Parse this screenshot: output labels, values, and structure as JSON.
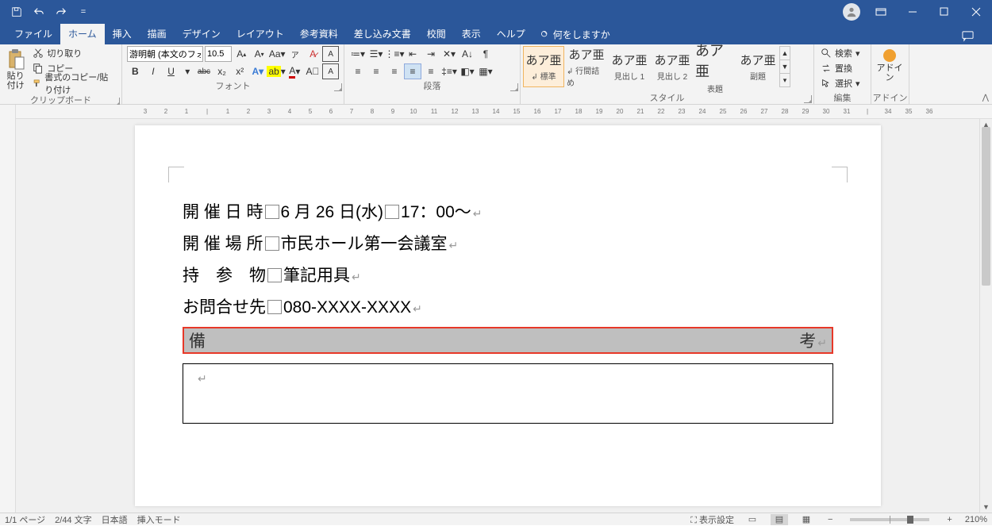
{
  "qat": {
    "save": "保存",
    "undo": "元に戻す",
    "redo": "やり直し",
    "custom": "="
  },
  "window": {
    "account": "アカウント"
  },
  "tabs": {
    "file": "ファイル",
    "home": "ホーム",
    "insert": "挿入",
    "draw": "描画",
    "design": "デザイン",
    "layout": "レイアウト",
    "references": "参考資料",
    "mailings": "差し込み文書",
    "review": "校閲",
    "view": "表示",
    "help": "ヘルプ",
    "tellme": "何をしますか"
  },
  "clipboard": {
    "paste": "貼り付け",
    "cut": "切り取り",
    "copy": "コピー",
    "formatPainter": "書式のコピー/貼り付け",
    "group": "クリップボード"
  },
  "font": {
    "name": "游明朝 (本文のフォン",
    "size": "10.5",
    "group": "フォント",
    "bold": "B",
    "italic": "I",
    "underline": "U",
    "strike": "abc",
    "sub": "x₂",
    "sup": "x²"
  },
  "paragraph": {
    "group": "段落"
  },
  "styles": {
    "group": "スタイル",
    "items": [
      {
        "preview": "あア亜",
        "label": "↲ 標準"
      },
      {
        "preview": "あア亜",
        "label": "↲ 行間詰め"
      },
      {
        "preview": "あア亜",
        "label": "見出し 1"
      },
      {
        "preview": "あア亜",
        "label": "見出し 2"
      },
      {
        "preview": "あア亜",
        "label": "表題"
      },
      {
        "preview": "あア亜",
        "label": "副題"
      }
    ]
  },
  "editing": {
    "find": "検索",
    "replace": "置換",
    "select": "選択",
    "group": "編集"
  },
  "addins": {
    "label": "アドイン",
    "group": "アドイン"
  },
  "document": {
    "line1_label": "開 催 日 時",
    "line1_value": "6 月 26 日(水)",
    "line1_time": "17：00～",
    "line2_label": "開 催 場 所",
    "line2_value": "市民ホール第一会議室",
    "line3_label": "持　参　物",
    "line3_value": "筆記用具",
    "line4_label": "お問合せ先",
    "line4_value": "080-XXXX-XXXX",
    "biko_left": "備",
    "biko_right": "考",
    "ret": "↵"
  },
  "status": {
    "page": "1/1 ページ",
    "words": "2/44 文字",
    "lang": "日本語",
    "mode": "挿入モード",
    "display": "表示設定",
    "zoom": "210%",
    "minus": "−",
    "plus": "+"
  }
}
